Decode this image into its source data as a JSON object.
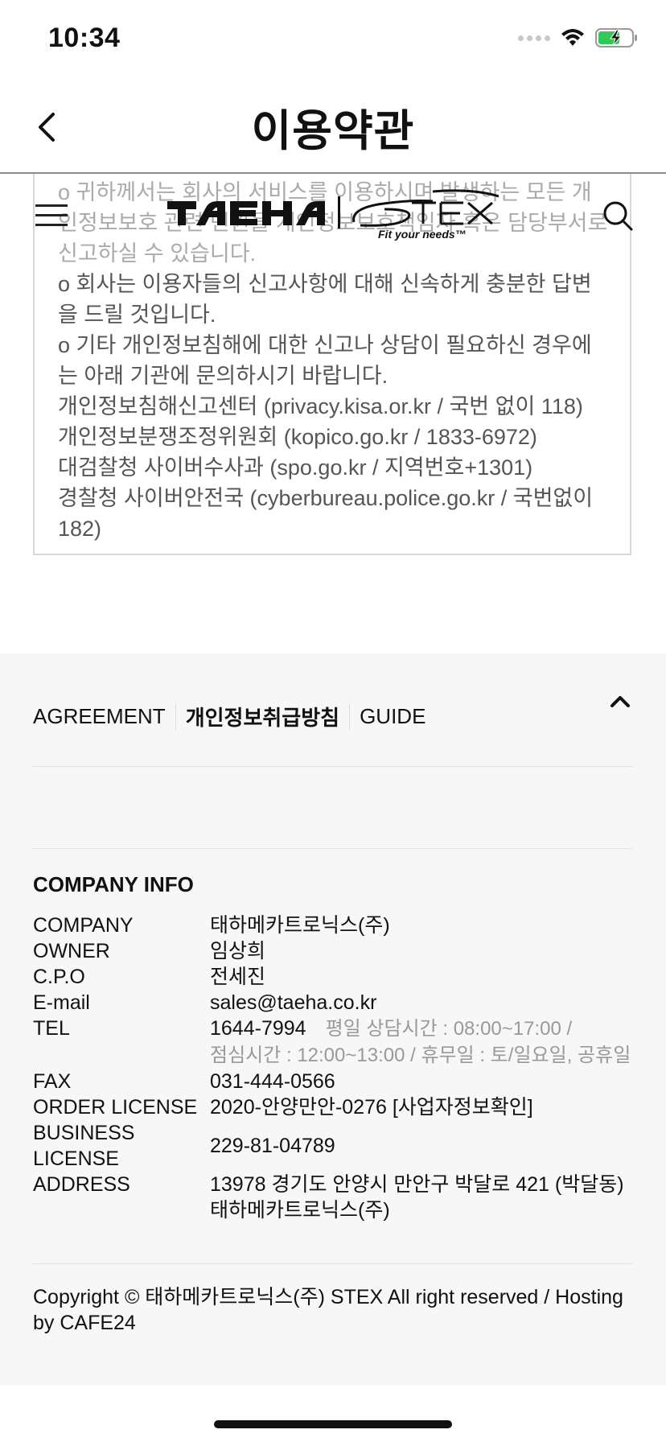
{
  "status_bar": {
    "time": "10:34",
    "battery_color": "#34c759"
  },
  "nav": {
    "title": "이용약관",
    "back_icon": "chevron-left-icon"
  },
  "site_header": {
    "menu_icon": "hamburger-icon",
    "logo_icon": "taeha-stex-logo",
    "search_icon": "search-icon"
  },
  "terms": {
    "lines": [
      "o 귀하께서는 회사의 서비스를 이용하시며 발생하는 모든 개인정보보호 관련 민원을 개인정보보호책임자 혹은 담당부서로 신고하실 수 있습니다.",
      "o 회사는 이용자들의 신고사항에 대해 신속하게 충분한 답변을 드릴 것입니다.",
      "o 기타 개인정보침해에 대한 신고나 상담이 필요하신 경우에는 아래 기관에 문의하시기 바랍니다.",
      "개인정보침해신고센터 (privacy.kisa.or.kr / 국번 없이 118)",
      "개인정보분쟁조정위원회 (kopico.go.kr / 1833-6972)",
      "대검찰청 사이버수사과 (spo.go.kr / 지역번호+1301)",
      "경찰청 사이버안전국 (cyberbureau.police.go.kr / 국번없이 182)"
    ]
  },
  "footer": {
    "links": [
      "AGREEMENT",
      "개인정보취급방침",
      "GUIDE"
    ],
    "top_icon": "chevron-up-icon",
    "company_info_title": "COMPANY INFO",
    "company": {
      "label": "COMPANY",
      "value": "태하메카트로닉스(주)"
    },
    "owner": {
      "label": "OWNER",
      "value": "임상희"
    },
    "cpo": {
      "label": "C.P.O",
      "value": "전세진"
    },
    "email": {
      "label": "E-mail",
      "value": "sales@taeha.co.kr"
    },
    "tel": {
      "label": "TEL",
      "value": "1644-7994",
      "note1": "평일 상담시간 : 08:00~17:00 /",
      "note2": "점심시간 : 12:00~13:00 / 휴무일 : 토/일요일, 공휴일"
    },
    "fax": {
      "label": "FAX",
      "value": "031-444-0566"
    },
    "order_license": {
      "label": "ORDER LICENSE",
      "value": "2020-안양만안-0276 [사업자정보확인]"
    },
    "business_license": {
      "label1": "BUSINESS",
      "label2": "LICENSE",
      "value": "229-81-04789"
    },
    "address": {
      "label": "ADDRESS",
      "value1": "13978 경기도 안양시 만안구 박달로 421 (박달동)",
      "value2": "태하메카트로닉스(주)"
    },
    "copyright": "Copyright © 태하메카트로닉스(주) STEX All right reserved / Hosting by CAFE24"
  }
}
